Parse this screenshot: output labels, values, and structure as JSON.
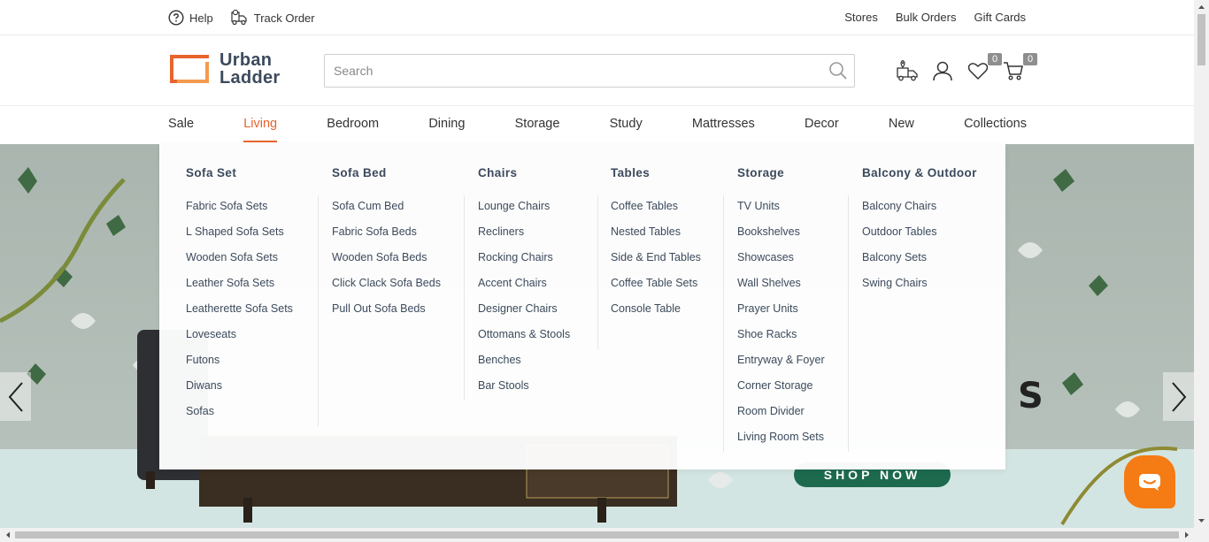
{
  "utility": {
    "help": "Help",
    "track_order": "Track Order",
    "stores": "Stores",
    "bulk_orders": "Bulk Orders",
    "gift_cards": "Gift Cards"
  },
  "logo": {
    "line1": "Urban",
    "line2": "Ladder"
  },
  "search": {
    "placeholder": "Search",
    "value": ""
  },
  "header_icons": {
    "wishlist_count": "0",
    "cart_count": "0"
  },
  "nav": {
    "items": [
      "Sale",
      "Living",
      "Bedroom",
      "Dining",
      "Storage",
      "Study",
      "Mattresses",
      "Decor",
      "New",
      "Collections"
    ],
    "active": "Living"
  },
  "mega_menu": {
    "columns": [
      {
        "title": "Sofa Set",
        "items": [
          "Fabric Sofa Sets",
          "L Shaped Sofa Sets",
          "Wooden Sofa Sets",
          "Leather Sofa Sets",
          "Leatherette Sofa Sets",
          "Loveseats",
          "Futons",
          "Diwans",
          "Sofas"
        ]
      },
      {
        "title": "Sofa Bed",
        "items": [
          "Sofa Cum Bed",
          "Fabric Sofa Beds",
          "Wooden Sofa Beds",
          "Click Clack Sofa Beds",
          "Pull Out Sofa Beds"
        ]
      },
      {
        "title": "Chairs",
        "items": [
          "Lounge Chairs",
          "Recliners",
          "Rocking Chairs",
          "Accent Chairs",
          "Designer Chairs",
          "Ottomans & Stools",
          "Benches",
          "Bar Stools"
        ]
      },
      {
        "title": "Tables",
        "items": [
          "Coffee Tables",
          "Nested Tables",
          "Side & End Tables",
          "Coffee Table Sets",
          "Console Table"
        ]
      },
      {
        "title": "Storage",
        "items": [
          "TV Units",
          "Bookshelves",
          "Showcases",
          "Wall Shelves",
          "Prayer Units",
          "Shoe Racks",
          "Entryway & Foyer",
          "Corner Storage",
          "Room Divider",
          "Living Room Sets"
        ]
      },
      {
        "title": "Balcony & Outdoor",
        "items": [
          "Balcony Chairs",
          "Outdoor Tables",
          "Balcony Sets",
          "Swing Chairs"
        ]
      }
    ]
  },
  "hero": {
    "visible_text": "S",
    "cta": "SHOP NOW"
  },
  "colors": {
    "accent": "#e8642d",
    "text": "#3c4a5c",
    "cta_bg": "#1d6a4f",
    "chat_bg": "#f57b14"
  }
}
